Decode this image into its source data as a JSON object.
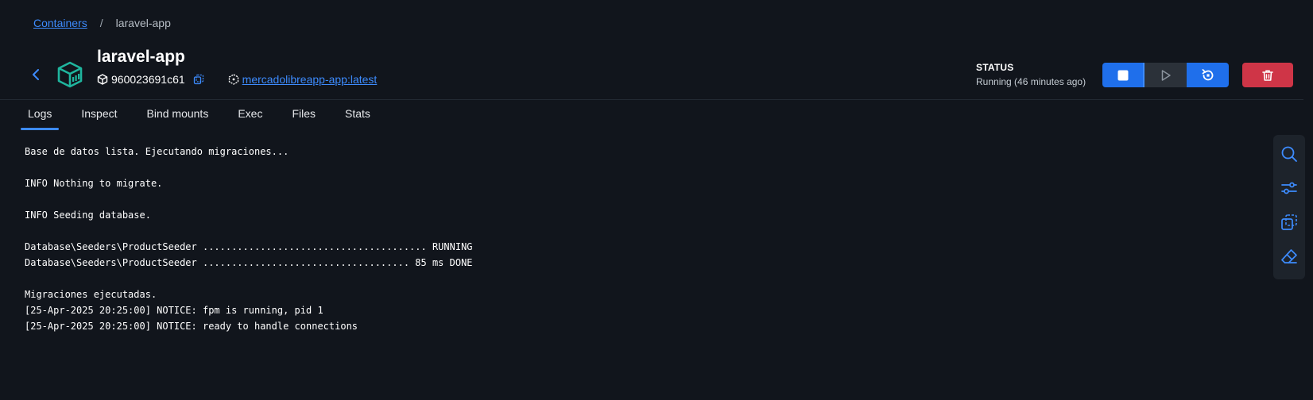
{
  "breadcrumb": {
    "parent": "Containers",
    "separator": "/",
    "current": "laravel-app"
  },
  "container": {
    "name": "laravel-app",
    "id": "960023691c61",
    "image": "mercadolibreapp-app:latest"
  },
  "status": {
    "label": "STATUS",
    "value": "Running (46 minutes ago)"
  },
  "tabs": [
    {
      "label": "Logs"
    },
    {
      "label": "Inspect"
    },
    {
      "label": "Bind mounts"
    },
    {
      "label": "Exec"
    },
    {
      "label": "Files"
    },
    {
      "label": "Stats"
    }
  ],
  "logs": [
    "Base de datos lista. Ejecutando migraciones...",
    "",
    "INFO Nothing to migrate.",
    "",
    "INFO Seeding database.",
    "",
    "Database\\Seeders\\ProductSeeder ....................................... RUNNING",
    "Database\\Seeders\\ProductSeeder .................................... 85 ms DONE",
    "",
    "Migraciones ejecutadas.",
    "[25-Apr-2025 20:25:00] NOTICE: fpm is running, pid 1",
    "[25-Apr-2025 20:25:00] NOTICE: ready to handle connections"
  ],
  "icons": {
    "back": "chevron-left-icon",
    "container": "container-box-icon",
    "id": "cube-icon",
    "copy": "copy-icon",
    "image": "image-layers-icon",
    "stop": "stop-icon",
    "play": "play-icon",
    "restart": "restart-icon",
    "delete": "trash-icon",
    "search": "search-icon",
    "filter": "filter-icon",
    "select": "select-copy-icon",
    "clear": "eraser-icon"
  },
  "colors": {
    "background": "#11151c",
    "accent": "#1f6feb",
    "link": "#3d8bfd",
    "danger": "#cf3547",
    "container_icon": "#1fb59e"
  }
}
